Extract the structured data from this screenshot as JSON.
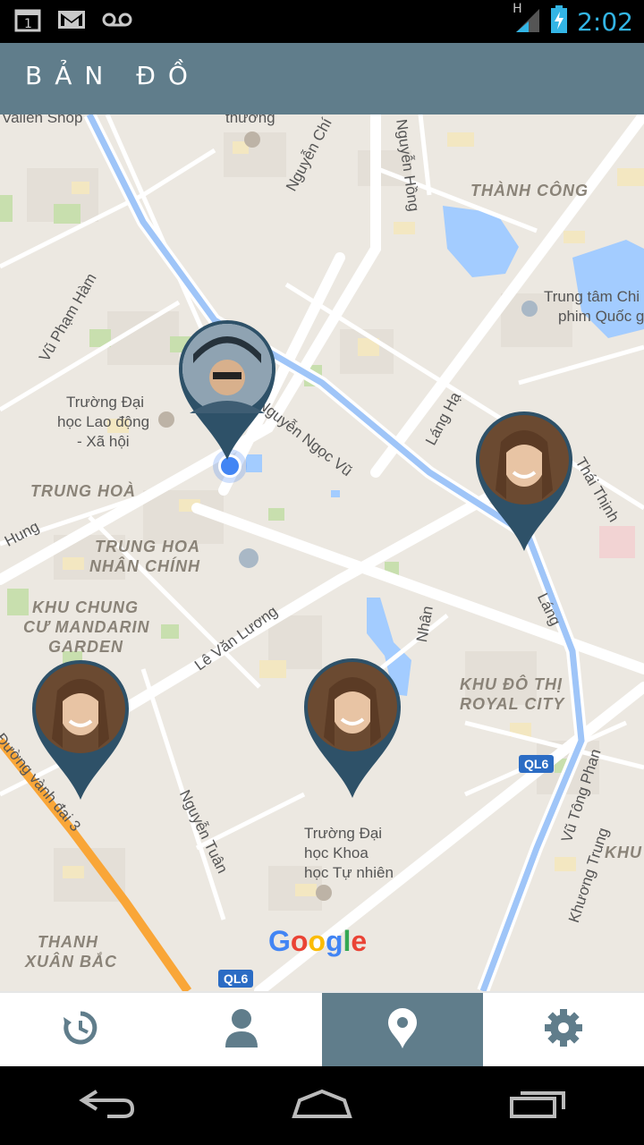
{
  "status_bar": {
    "time": "2:02",
    "network_type": "H",
    "icons": [
      "calendar-icon",
      "gmail-icon",
      "voicemail-icon",
      "signal-icon",
      "battery-charging-icon"
    ],
    "calendar_day": "1"
  },
  "app_bar": {
    "title": "BẢN ĐỒ"
  },
  "map": {
    "labels": {
      "vallen_shop": "Vallen Shop",
      "thuong": "thương",
      "nguyen_chi_thanh": "Nguyễn Chí Thanh",
      "nguyen_hong": "Nguyễn Hồng",
      "thanh_cong": "THÀNH CÔNG",
      "trung_tam_1": "Trung tâm Chi",
      "trung_tam_2": "phim Quốc gia",
      "vu_pham_ham": "Vũ Phạm Hàm",
      "truong_ld_1": "Trường Đại",
      "truong_ld_2": "học Lao động",
      "truong_ld_3": "- Xã hội",
      "nguyen_ngoc_vu": "Nguyễn Ngọc Vũ",
      "lang_ha": "Láng Hạ",
      "trung_hoa": "TRUNG HOÀ",
      "hung": "Hung",
      "thai_thinh": "Thái Thịnh",
      "trung_hoa_nhan_chinh_1": "TRUNG HOA",
      "trung_hoa_nhan_chinh_2": "NHÂN CHÍNH",
      "lang": "Láng",
      "khu_chung_cu_1": "KHU CHUNG",
      "khu_chung_cu_2": "CƯ MANDARIN",
      "khu_chung_cu_3": "GARDEN",
      "le_van_luong": "Lê Văn Lương",
      "nhan": "Nhân",
      "khu_do_thi_1": "KHU ĐÔ THỊ",
      "khu_do_thi_2": "ROYAL CITY",
      "ql6": "QL6",
      "vu_tong_phan": "Vũ Tông Phan",
      "duong_vanh_dai_3": "Đường vành đai 3",
      "nguyen_tuan": "Nguyễn Tuân",
      "truong_khtn_1": "Trường Đại",
      "truong_khtn_2": "học Khoa",
      "truong_khtn_3": "học Tự nhiên",
      "khuong_trung": "Khương Trung",
      "khu": "KHU",
      "thanh_xuan_bac_1": "THANH",
      "thanh_xuan_bac_2": "XUÂN BẮC",
      "google": "Google",
      "ql6_bottom": "QL6"
    }
  },
  "pins": [
    {
      "name": "user-pin-self",
      "avatar": "man-with-cap-avatar"
    },
    {
      "name": "friend-pin-1",
      "avatar": "woman-avatar"
    },
    {
      "name": "friend-pin-2",
      "avatar": "woman-avatar"
    },
    {
      "name": "friend-pin-3",
      "avatar": "woman-avatar"
    }
  ],
  "tabs": [
    {
      "name": "history",
      "icon": "history-icon",
      "active": false
    },
    {
      "name": "profile",
      "icon": "person-icon",
      "active": false
    },
    {
      "name": "map",
      "icon": "location-pin-icon",
      "active": true
    },
    {
      "name": "settings",
      "icon": "gear-icon",
      "active": false
    }
  ],
  "nav_bar": {
    "icons": [
      "back-icon",
      "home-icon",
      "recent-apps-icon"
    ]
  },
  "colors": {
    "primary": "#607d8b",
    "pin": "#2e5168",
    "water": "#a3ccff",
    "highway": "#f9a638",
    "arterial": "#9fc5f8"
  }
}
